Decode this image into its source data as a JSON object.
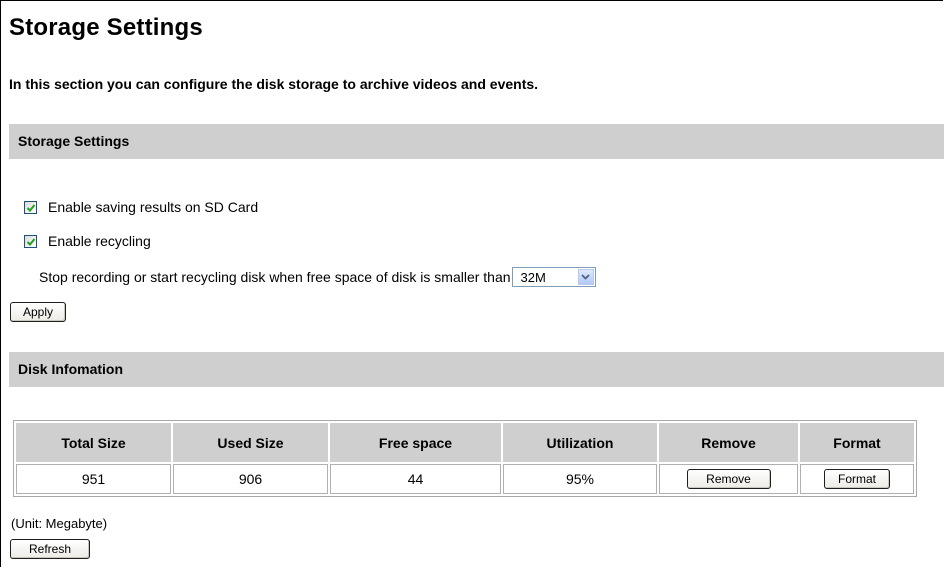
{
  "page": {
    "title": "Storage Settings",
    "intro": "In this section you can configure the disk storage to archive videos and events."
  },
  "storage_section": {
    "header": "Storage Settings",
    "enable_sd_label": "Enable saving results on SD Card",
    "enable_sd_checked": true,
    "enable_recycling_label": "Enable recycling",
    "enable_recycling_checked": true,
    "stop_recording_label": "Stop recording or start recycling disk when free space of disk is smaller than",
    "free_space_select": "32M",
    "apply_label": "Apply"
  },
  "disk_section": {
    "header": "Disk Infomation",
    "columns": [
      "Total Size",
      "Used Size",
      "Free space",
      "Utilization",
      "Remove",
      "Format"
    ],
    "row": {
      "total_size": "951",
      "used_size": "906",
      "free_space": "44",
      "utilization": "95%",
      "remove_label": "Remove",
      "format_label": "Format"
    },
    "unit_note": "(Unit: Megabyte)",
    "refresh_label": "Refresh"
  },
  "colors": {
    "section_bar": "#cfcfcf",
    "checkbox_border": "#1c5180",
    "checkmark": "#21a121"
  }
}
